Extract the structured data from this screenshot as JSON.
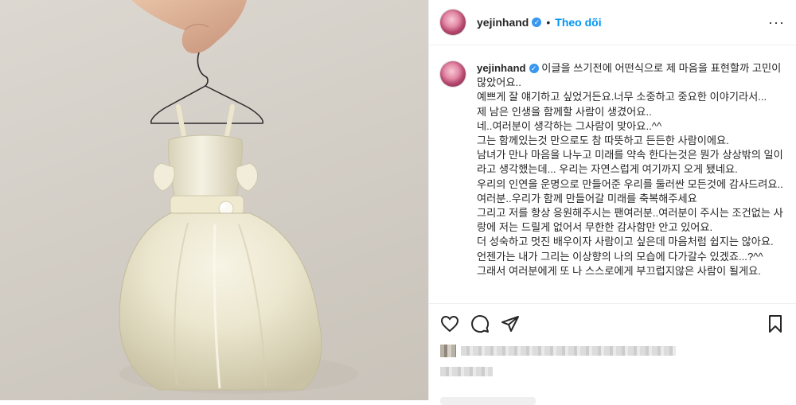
{
  "header": {
    "username": "yejinhand",
    "verified_mark": "✓",
    "separator": "•",
    "follow_label": "Theo dõi",
    "more_label": "···"
  },
  "caption": {
    "username": "yejinhand",
    "lines": [
      "이글을 쓰기전에 어떤식으로 제 마음을 표현할까 고민이 많았어요..",
      "예쁘게 잘 얘기하고 싶었거든요.너무 소중하고 중요한 이야기라서...",
      "제 남은 인생을 함께할 사람이 생겼어요..",
      "네..여러분이 생각하는 그사람이 맞아요..^^",
      "그는 함께있는것 만으로도 참 따뜻하고 든든한 사람이에요.",
      "남녀가 만나 마음을 나누고 미래를 약속 한다는것은 뭔가 상상밖의 일이라고 생각했는데... 우리는 자연스럽게 여기까지 오게 됐네요.",
      "우리의 인연을 운명으로 만들어준 우리를 둘러싼 모든것에 감사드려요..",
      "여러분..우리가 함께 만들어갈 미래를 축복해주세요",
      "",
      "그리고 저를 항상 응원해주시는 팬여러분..여러분이 주시는 조건없는 사랑에 저는 드릴게 없어서 무한한 감사함만 안고 있어요.",
      "더 성숙하고 멋진 배우이자 사람이고 싶은데 마음처럼 쉽지는 않아요. 언젠가는 내가 그리는 이상향의 나의 모습에 다가갈수 있겠죠...?^^",
      "그래서 여러분에게 또 나 스스로에게 부끄럽지않은 사람이 될게요."
    ]
  },
  "actions": {
    "like_icon": "heart-icon",
    "comment_icon": "comment-icon",
    "share_icon": "paper-plane-icon",
    "save_icon": "bookmark-icon"
  },
  "colors": {
    "accent": "#0095f6",
    "verified": "#3897f0",
    "text": "#262626",
    "border": "#efefef"
  }
}
